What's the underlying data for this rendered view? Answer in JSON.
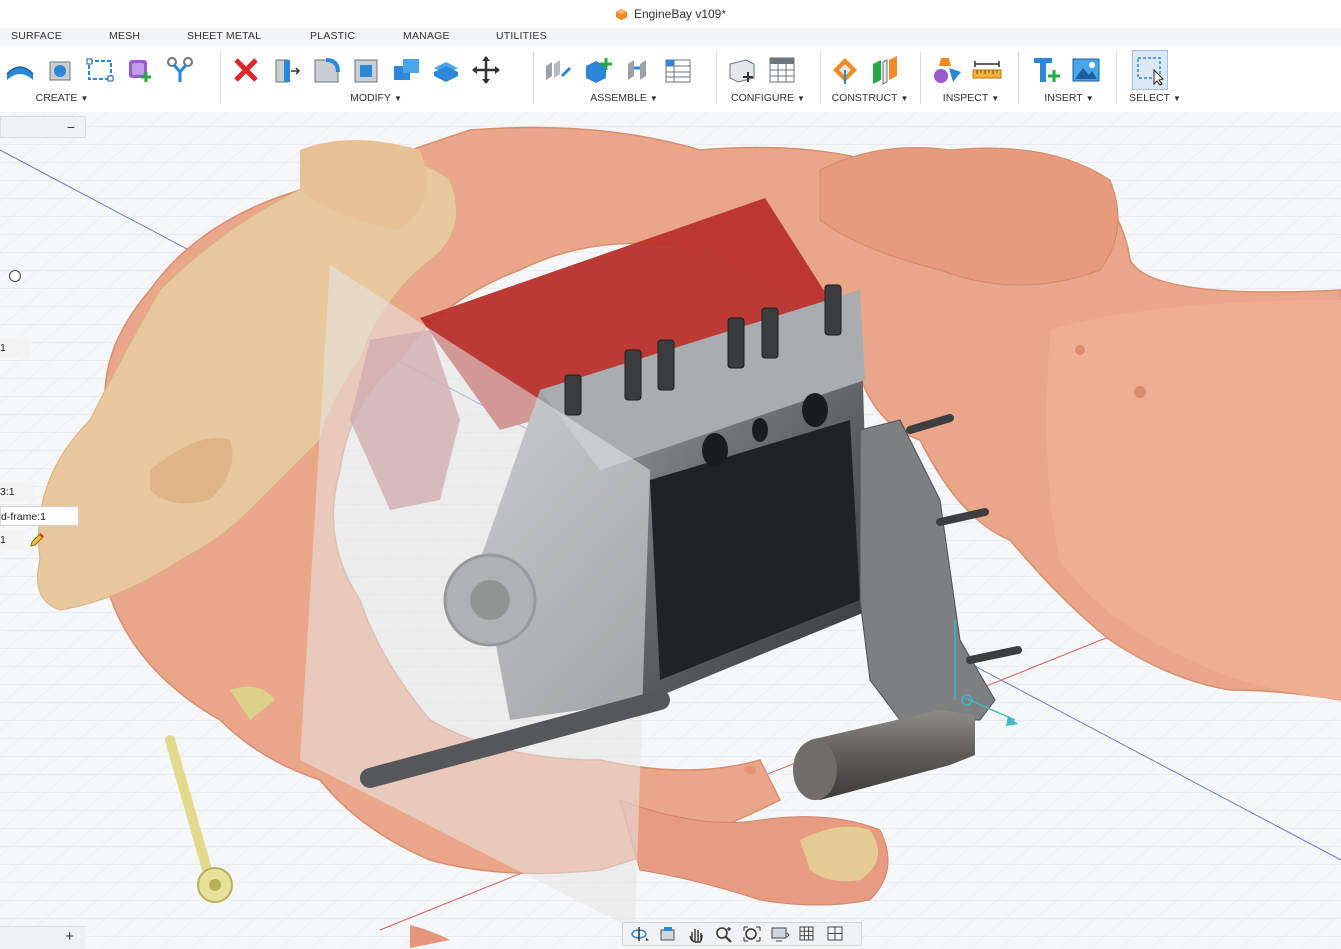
{
  "window": {
    "title": "EngineBay v109*"
  },
  "tabs": [
    "SURFACE",
    "MESH",
    "SHEET METAL",
    "PLASTIC",
    "MANAGE",
    "UTILITIES"
  ],
  "groups": {
    "create": "CREATE",
    "modify": "MODIFY",
    "assemble": "ASSEMBLE",
    "configure": "CONFIGURE",
    "construct": "CONSTRUCT",
    "inspect": "INSPECT",
    "insert": "INSERT",
    "select": "SELECT"
  },
  "browser": {
    "collapse_symbol": "−",
    "items": [
      "1",
      "3:1",
      "d-frame:1",
      "1"
    ],
    "add_symbol": "+"
  },
  "icons": {
    "create": [
      "patch-surface-icon",
      "extrude-surface-icon",
      "sketch-icon",
      "component-add-icon",
      "joint-icon"
    ],
    "modify": [
      "delete-icon",
      "press-pull-icon",
      "fillet-icon",
      "shell-icon",
      "combine-icon",
      "offset-face-icon",
      "move-icon"
    ],
    "assemble": [
      "joint-icon",
      "new-component-icon",
      "as-built-joint-icon",
      "table-icon"
    ],
    "configure": [
      "configure-icon",
      "configure-table-icon"
    ],
    "construct": [
      "plane-icon",
      "midplane-icon"
    ],
    "inspect": [
      "inspect-shapes-icon",
      "measure-icon"
    ],
    "insert": [
      "insert-derive-icon",
      "insert-image-icon"
    ],
    "select": [
      "window-select-icon"
    ],
    "navbar": [
      "orbit-icon",
      "look-at-icon",
      "pan-icon",
      "zoom-icon",
      "fit-icon",
      "display-settings-icon",
      "grid-icon",
      "viewports-icon"
    ]
  },
  "colors": {
    "accent": "#1e8fd6",
    "mesh_salmon": "#e9a58a",
    "mesh_tan": "#e4c79c",
    "plane_red": "#b8322d",
    "engine_gray": "#7d7f80"
  }
}
